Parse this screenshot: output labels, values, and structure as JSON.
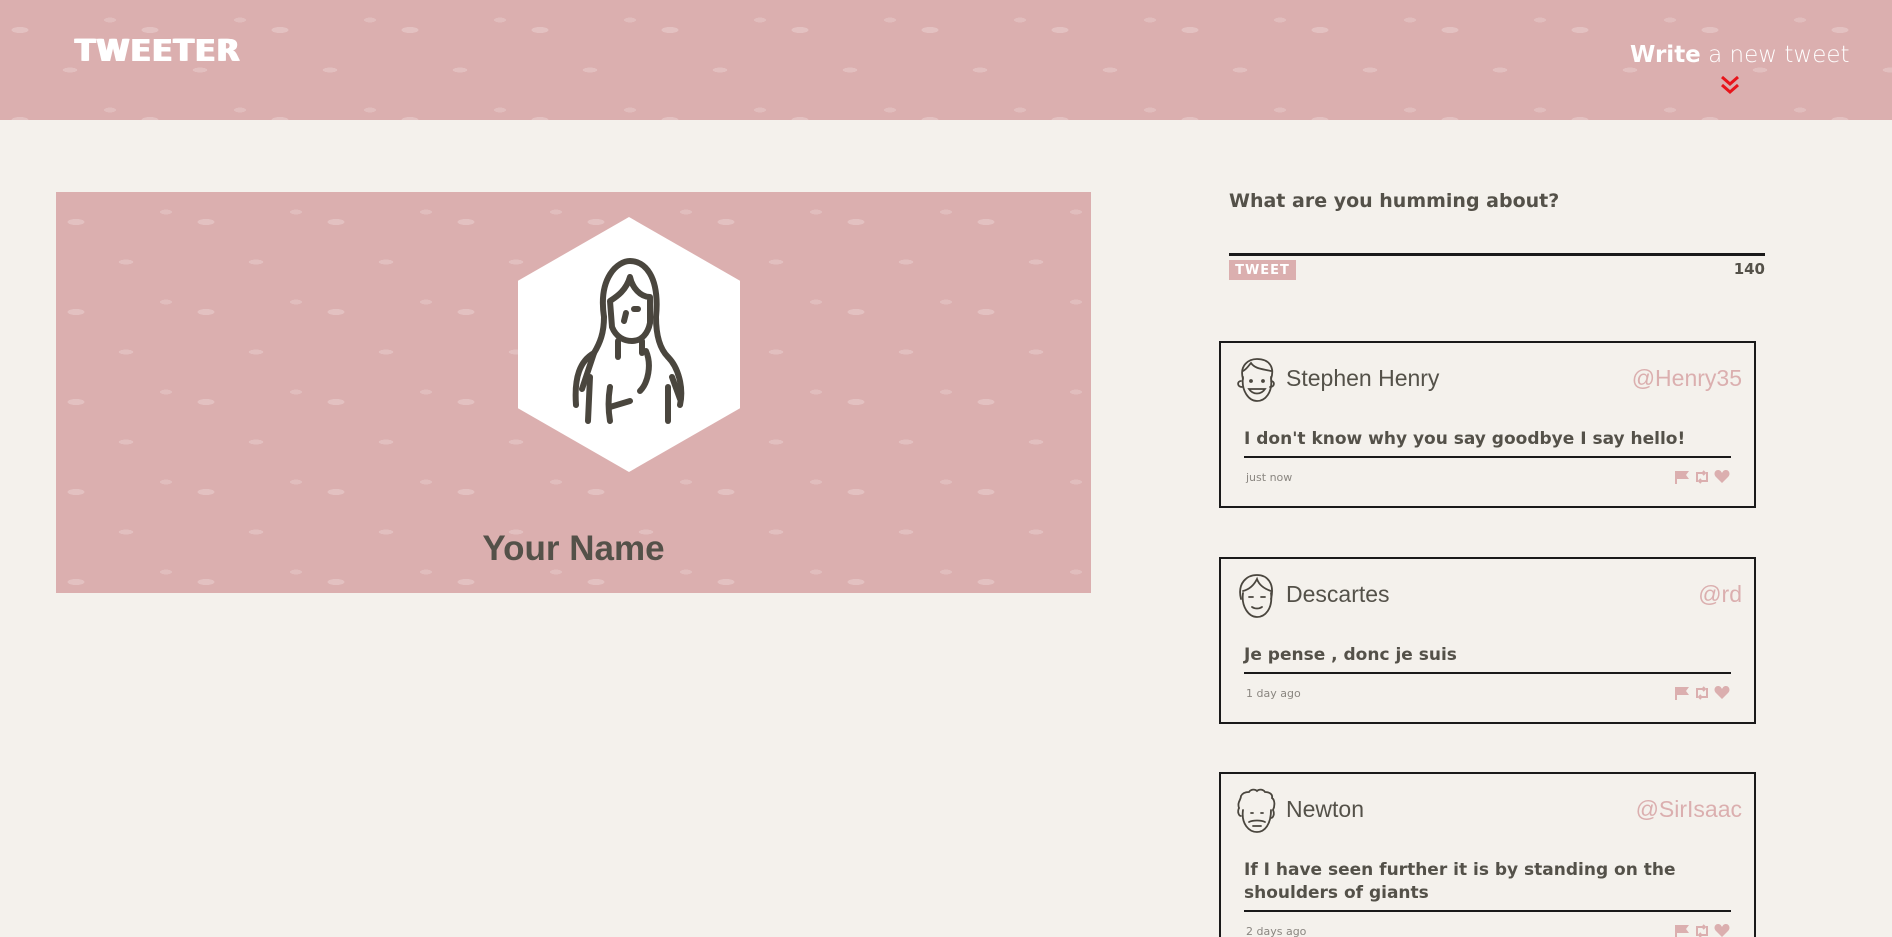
{
  "nav": {
    "logo": "TWEETER",
    "compose_bold": "Write",
    "compose_rest": " a new tweet",
    "compose_icon": "double-chevron-down-icon"
  },
  "profile": {
    "name": "Your Name",
    "avatar_icon": "woman-avatar-icon"
  },
  "compose": {
    "label": "What are you humming about?",
    "input_value": "",
    "button_label": "TWEET",
    "counter": "140"
  },
  "tweets": [
    {
      "name": "Stephen Henry",
      "handle": "@Henry35",
      "text": "I don't know why you say goodbye I say hello!",
      "time": "just now",
      "avatar_icon": "smiling-man-avatar-icon"
    },
    {
      "name": "Descartes",
      "handle": "@rd",
      "text": "Je pense , donc je suis",
      "time": "1 day ago",
      "avatar_icon": "man-avatar-icon"
    },
    {
      "name": "Newton",
      "handle": "@SirIsaac",
      "text": "If I have seen further it is by standing on the shoulders of giants",
      "time": "2 days ago",
      "avatar_icon": "curly-hair-man-avatar-icon"
    }
  ],
  "tweet_action_icons": [
    "flag-icon",
    "retweet-icon",
    "heart-icon"
  ],
  "colors": {
    "accent_pink": "#dbafaf",
    "background": "#f4f1ec",
    "text": "#545149",
    "chevron_red": "#e8141b"
  }
}
